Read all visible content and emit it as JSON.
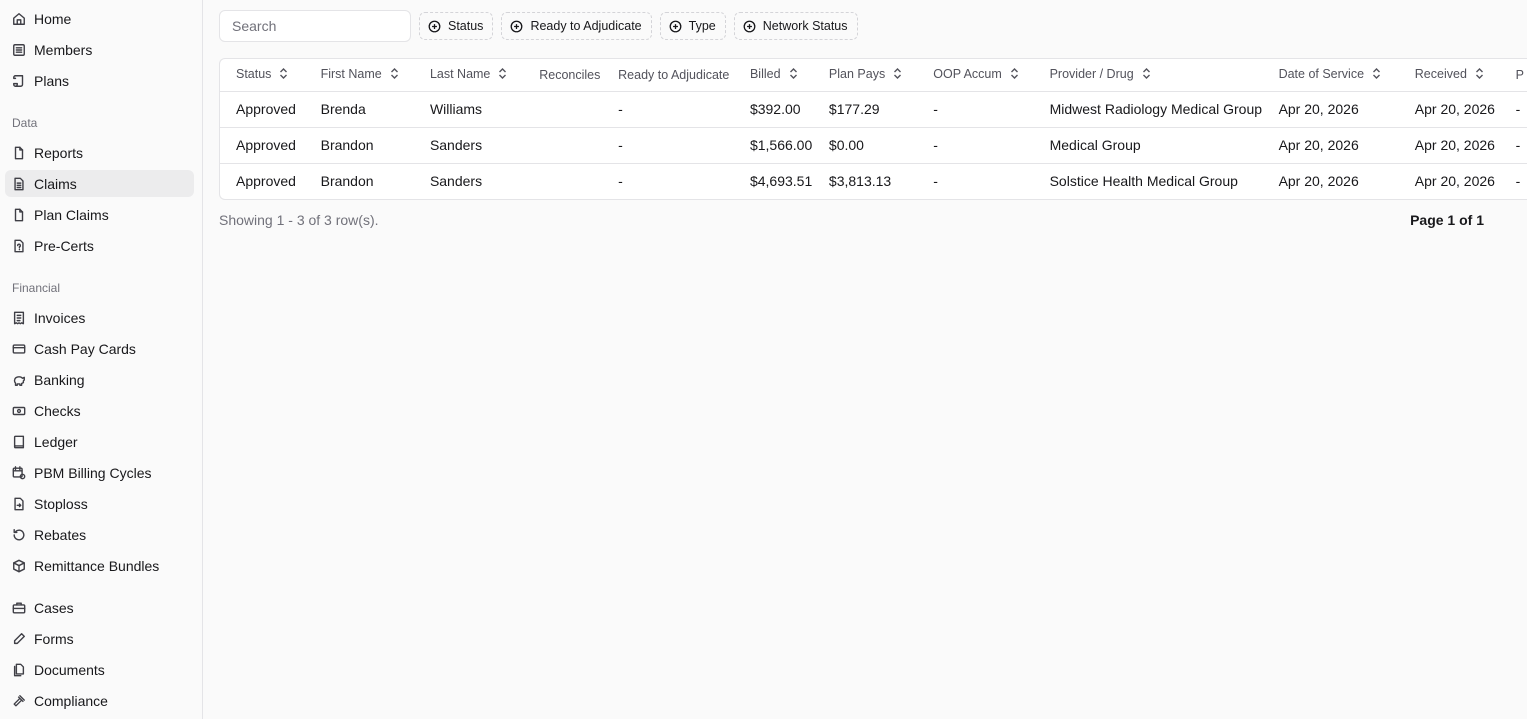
{
  "sidebar": {
    "top": [
      {
        "label": "Home",
        "icon": "home-icon"
      },
      {
        "label": "Members",
        "icon": "list-icon"
      },
      {
        "label": "Plans",
        "icon": "scroll-icon"
      }
    ],
    "data_label": "Data",
    "data": [
      {
        "label": "Reports",
        "icon": "file-icon"
      },
      {
        "label": "Claims",
        "icon": "file-text-icon",
        "active": true
      },
      {
        "label": "Plan Claims",
        "icon": "file-icon"
      },
      {
        "label": "Pre-Certs",
        "icon": "file-question-icon"
      }
    ],
    "financial_label": "Financial",
    "financial": [
      {
        "label": "Invoices",
        "icon": "receipt-icon"
      },
      {
        "label": "Cash Pay Cards",
        "icon": "credit-card-icon"
      },
      {
        "label": "Banking",
        "icon": "piggy-bank-icon"
      },
      {
        "label": "Checks",
        "icon": "banknote-icon"
      },
      {
        "label": "Ledger",
        "icon": "book-icon"
      },
      {
        "label": "PBM Billing Cycles",
        "icon": "calendar-cycle-icon"
      },
      {
        "label": "Stoploss",
        "icon": "file-stop-icon"
      },
      {
        "label": "Rebates",
        "icon": "refresh-icon"
      },
      {
        "label": "Remittance Bundles",
        "icon": "package-icon"
      }
    ],
    "other": [
      {
        "label": "Cases",
        "icon": "briefcase-icon"
      },
      {
        "label": "Forms",
        "icon": "pen-icon"
      },
      {
        "label": "Documents",
        "icon": "files-icon"
      },
      {
        "label": "Compliance",
        "icon": "gavel-icon"
      }
    ]
  },
  "toolbar": {
    "search_placeholder": "Search",
    "filters": [
      "Status",
      "Ready to Adjudicate",
      "Type",
      "Network Status"
    ]
  },
  "table": {
    "columns": [
      {
        "label": "Status",
        "sortable": true
      },
      {
        "label": "First Name",
        "sortable": true
      },
      {
        "label": "Last Name",
        "sortable": true
      },
      {
        "label": "Reconciles",
        "sortable": false
      },
      {
        "label": "Ready to Adjudicate",
        "sortable": false
      },
      {
        "label": "Billed",
        "sortable": true
      },
      {
        "label": "Plan Pays",
        "sortable": true
      },
      {
        "label": "OOP Accum",
        "sortable": true
      },
      {
        "label": "Provider / Drug",
        "sortable": true
      },
      {
        "label": "Date of Service",
        "sortable": true
      },
      {
        "label": "Received",
        "sortable": true
      },
      {
        "label": "P",
        "sortable": false
      }
    ],
    "rows": [
      [
        "Approved",
        "Brenda",
        "Williams",
        "",
        "-",
        "$392.00",
        "$177.29",
        "-",
        "Midwest Radiology Medical Group",
        "Apr 20, 2026",
        "Apr 20, 2026",
        "-"
      ],
      [
        "Approved",
        "Brandon",
        "Sanders",
        "",
        "-",
        "$1,566.00",
        "$0.00",
        "-",
        "Medical Group",
        "Apr 20, 2026",
        "Apr 20, 2026",
        "-"
      ],
      [
        "Approved",
        "Brandon",
        "Sanders",
        "",
        "-",
        "$4,693.51",
        "$3,813.13",
        "-",
        "Solstice Health Medical Group",
        "Apr 20, 2026",
        "Apr 20, 2026",
        "-"
      ]
    ]
  },
  "footer": {
    "count": "Showing 1 - 3 of 3 row(s).",
    "page": "Page 1 of 1"
  }
}
